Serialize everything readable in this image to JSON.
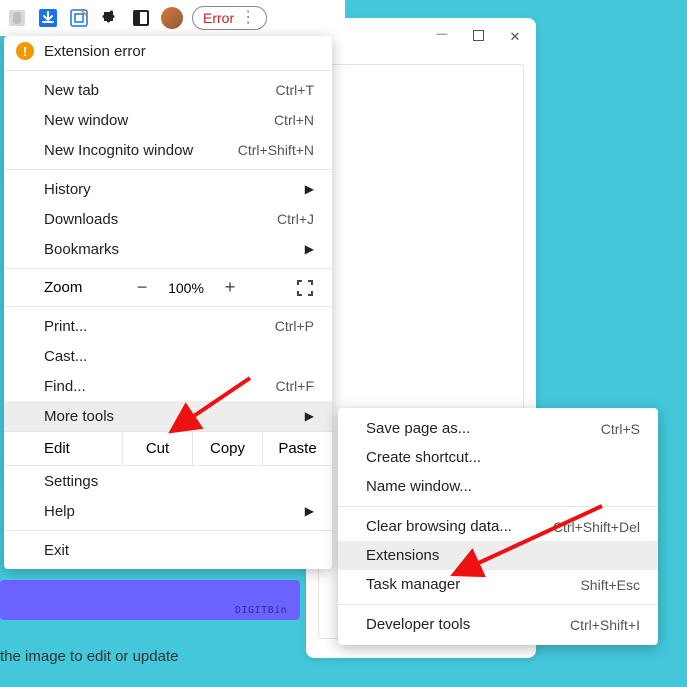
{
  "toolbar": {
    "error_label": "Error"
  },
  "menu": {
    "header": "Extension error",
    "new_tab": {
      "label": "New tab",
      "shortcut": "Ctrl+T"
    },
    "new_window": {
      "label": "New window",
      "shortcut": "Ctrl+N"
    },
    "new_incognito": {
      "label": "New Incognito window",
      "shortcut": "Ctrl+Shift+N"
    },
    "history": {
      "label": "History"
    },
    "downloads": {
      "label": "Downloads",
      "shortcut": "Ctrl+J"
    },
    "bookmarks": {
      "label": "Bookmarks"
    },
    "zoom": {
      "label": "Zoom",
      "minus": "−",
      "value": "100%",
      "plus": "+"
    },
    "print": {
      "label": "Print...",
      "shortcut": "Ctrl+P"
    },
    "cast": {
      "label": "Cast..."
    },
    "find": {
      "label": "Find...",
      "shortcut": "Ctrl+F"
    },
    "more_tools": {
      "label": "More tools"
    },
    "edit": {
      "label": "Edit",
      "cut": "Cut",
      "copy": "Copy",
      "paste": "Paste"
    },
    "settings": {
      "label": "Settings"
    },
    "help": {
      "label": "Help"
    },
    "exit": {
      "label": "Exit"
    }
  },
  "submenu": {
    "save_page": {
      "label": "Save page as...",
      "shortcut": "Ctrl+S"
    },
    "create_shortcut": {
      "label": "Create shortcut..."
    },
    "name_window": {
      "label": "Name window..."
    },
    "clear_data": {
      "label": "Clear browsing data...",
      "shortcut": "Ctrl+Shift+Del"
    },
    "extensions": {
      "label": "Extensions"
    },
    "task_manager": {
      "label": "Task manager",
      "shortcut": "Shift+Esc"
    },
    "developer_tools": {
      "label": "Developer tools",
      "shortcut": "Ctrl+Shift+I"
    }
  },
  "background": {
    "caption": "the image to edit or update",
    "watermark": "DIGITBin"
  }
}
